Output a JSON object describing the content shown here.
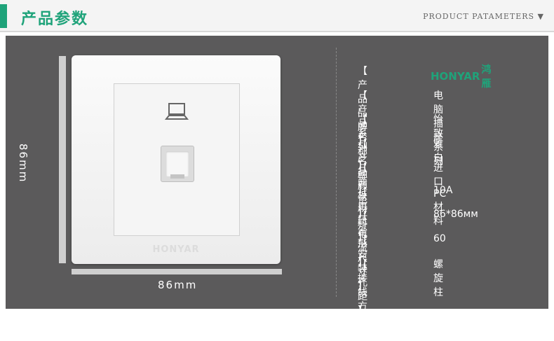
{
  "header": {
    "title": "产品参数",
    "subtitle": "PRODUCT PATAMETERS ▼"
  },
  "colors": {
    "accent": "#1fa37a",
    "panel": "#5b5a5b",
    "header_bg": "#f4f4f4"
  },
  "product_image": {
    "height_label": "86mm",
    "width_label": "86mm",
    "plate_brand": "HONYAR",
    "icon": "computer-icon"
  },
  "specs": [
    {
      "label": "【 产品品牌 】",
      "value": "",
      "logo_latin": "HONYAR",
      "logo_cjk": "鸿雁"
    },
    {
      "label": "【 产品名称 】",
      "value": "电脑插座"
    },
    {
      "label": "【 系列名称 】",
      "value": "怡致系列"
    },
    {
      "label": "【 产品颜色 】",
      "value": "雅白"
    },
    {
      "label": "【 面板材料 】",
      "value": "进口PC材料"
    },
    {
      "label": "【 电压电流 】",
      "value": "10A"
    },
    {
      "label": "【 外形尺寸 】",
      "value": "86*86ᴍᴍ"
    },
    {
      "label": "【 安装孔距 】",
      "value": "60"
    },
    {
      "label": "【 接线方式 】",
      "value": "螺旋柱"
    }
  ]
}
